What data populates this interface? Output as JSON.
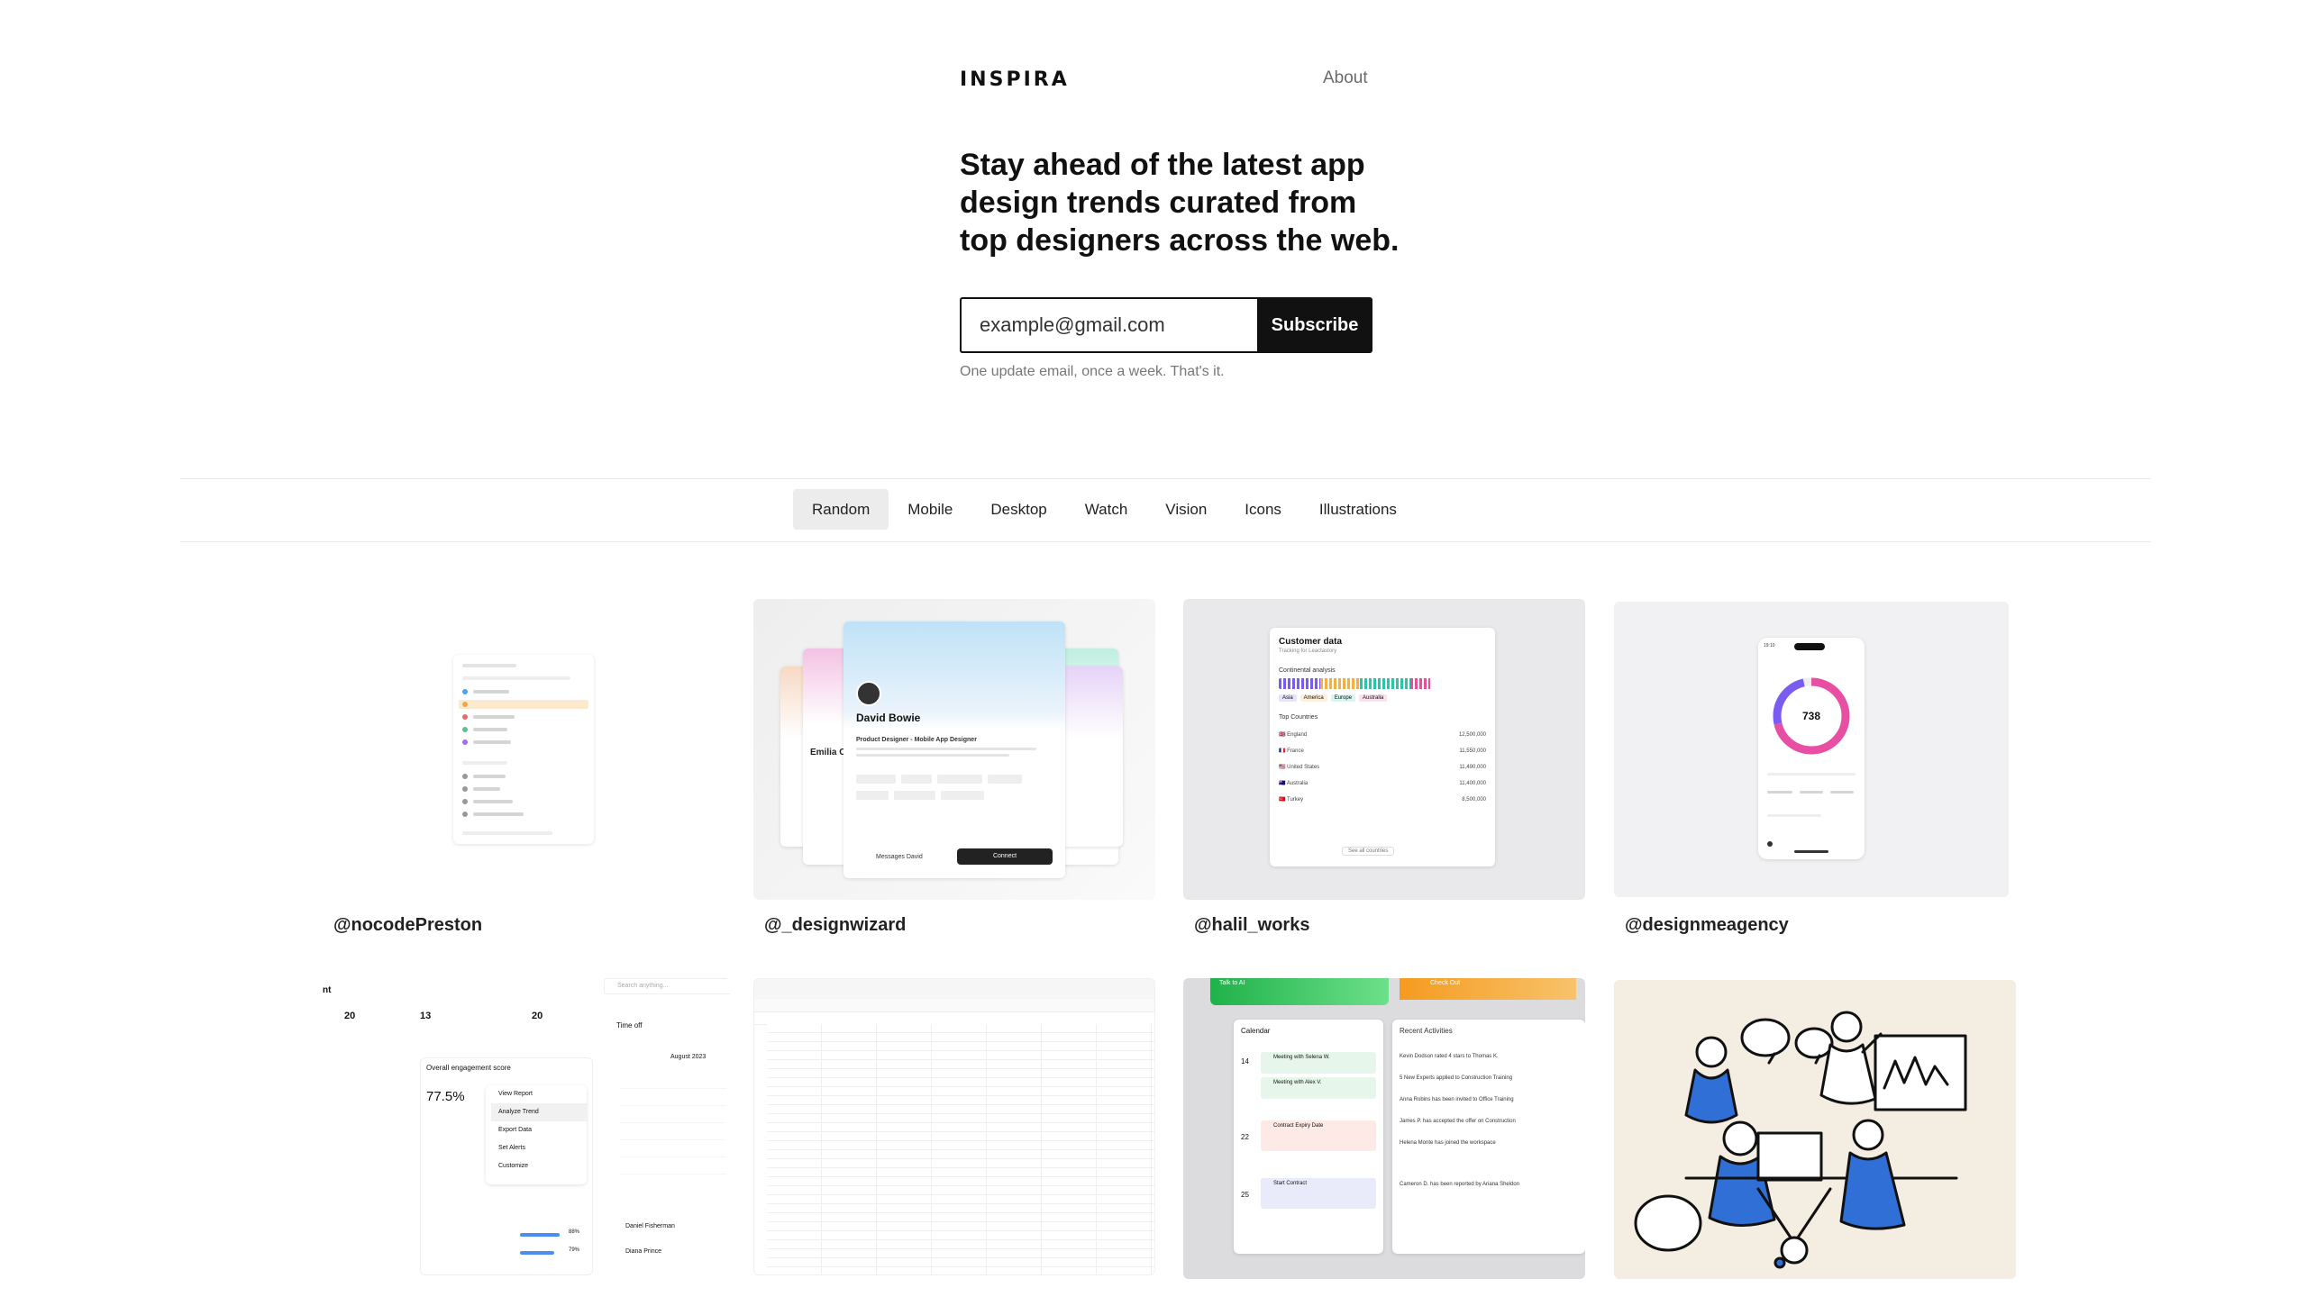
{
  "header": {
    "logo": "INSPIRA",
    "about": "About"
  },
  "hero": {
    "headline": "Stay ahead of the latest app design trends curated from top designers across the web.",
    "email_placeholder": "example@gmail.com",
    "subscribe_label": "Subscribe",
    "note": "One update email, once a week. That's it."
  },
  "tabs": [
    {
      "label": "Random",
      "active": true
    },
    {
      "label": "Mobile"
    },
    {
      "label": "Desktop"
    },
    {
      "label": "Watch"
    },
    {
      "label": "Vision"
    },
    {
      "label": "Icons"
    },
    {
      "label": "Illustrations"
    }
  ],
  "cards": [
    {
      "handle": "@nocodePreston"
    },
    {
      "handle": "@_designwizard"
    },
    {
      "handle": "@halil_works"
    },
    {
      "handle": "@designmeagency"
    }
  ],
  "previews": {
    "profile": {
      "name": "David Bowie",
      "title": "Product Designer - Mobile App Designer",
      "message": "Messages David",
      "connect": "Connect",
      "side_name": "Emilia C"
    },
    "customer": {
      "title": "Customer data",
      "subtitle": "Tracking for Leactastory",
      "section": "Continental analysis",
      "top": "Top Countries",
      "see_all": "See all countries",
      "tags": [
        "Asia",
        "America",
        "Europe",
        "Australia"
      ],
      "countries": [
        {
          "name": "England",
          "value": "12,500,000"
        },
        {
          "name": "France",
          "value": "11,550,000"
        },
        {
          "name": "United States",
          "value": "11,490,000"
        },
        {
          "name": "Australia",
          "value": "11,400,000"
        },
        {
          "name": "Turkey",
          "value": "8,500,000"
        }
      ]
    },
    "gauge": {
      "value": "738",
      "time": "19:10"
    },
    "engagement": {
      "new_hires": "20",
      "leave_requests": "13",
      "reviews_due": "20",
      "score_title": "Overall engagement score",
      "score": "77.5%",
      "menu": [
        "View Report",
        "Analyze Trend",
        "Export Data",
        "Set Alerts",
        "Customize"
      ],
      "time_off": "Time off",
      "month": "August 2023",
      "person1": "Daniel Fisherman",
      "person2": "Diana Prince",
      "search": "Search anything...",
      "pct1": "88%",
      "pct2": "79%"
    },
    "calendar": {
      "calendar": "Calendar",
      "recent": "Recent Activities",
      "check_out": "Check Out",
      "talk_to": "Talk to AI",
      "events": [
        "Meeting with Selena W.",
        "Meeting with Alex V.",
        "Contract Expiry Date",
        "Start Contract"
      ],
      "activities": [
        "Kevin Dodson rated 4 stars to Thomas K.",
        "5 New Experts applied to Construction Training",
        "Anna Robins has been invited to Office Training",
        "James P. has accepted the offer on Construction",
        "Helena Monte has joined the workspace",
        "Cameron D. has been reported by Ariana Sheldon"
      ],
      "day1": "14",
      "day2": "22",
      "day3": "25"
    }
  },
  "colors": {
    "accent": "#111111",
    "tab_active": "#ececec",
    "cream": "#f4ede2",
    "blue": "#2f6fd6"
  }
}
